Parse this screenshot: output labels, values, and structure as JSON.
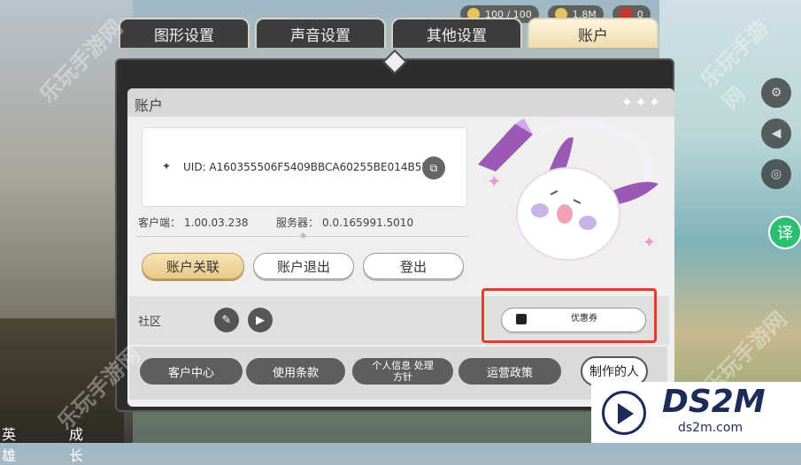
{
  "topbar": {
    "stamina": "100 / 100",
    "gold": "1.8M",
    "gems": "0"
  },
  "tabs": [
    {
      "label": "图形设置"
    },
    {
      "label": "声音设置"
    },
    {
      "label": "其他设置"
    },
    {
      "label": "账户"
    }
  ],
  "panel": {
    "title": "账户"
  },
  "account": {
    "uid": "UID: A160355506F5409BBCA60255BE014B5B",
    "client_label": "客户端：",
    "client_version": "1.00.03.238",
    "server_label": "服务器：",
    "server_version": "0.0.165991.5010"
  },
  "buttons": {
    "link": "账户关联",
    "logout": "账户退出",
    "login": "登出"
  },
  "community": {
    "label": "社区",
    "coupon": "优惠券"
  },
  "links": {
    "customer_center": "客户中心",
    "terms": "使用条款",
    "privacy": "个人信息 处理方针",
    "operation": "运营政策",
    "credits": "制作的人"
  },
  "side": {
    "translate": "译"
  },
  "bottom_nav": {
    "hero": "英雄",
    "growth": "成长"
  },
  "watermark": {
    "text": "乐玩手游网"
  },
  "logo": {
    "title": "DS2M",
    "sub": "ds2m.com"
  },
  "colors": {
    "highlight": "#e0402a",
    "accent_gold": "#e9c98a",
    "translate_green": "#2bbf72"
  }
}
